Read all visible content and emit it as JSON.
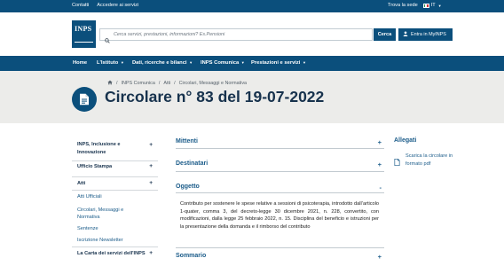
{
  "topbar": {
    "links": [
      "Contatti",
      "Accedere ai servizi"
    ],
    "find_office": "Trova la sede",
    "language": "IT",
    "colors": {
      "bar": "#0b4f7c"
    }
  },
  "header": {
    "logo_text": "INPS",
    "search_placeholder": "Cerca servizi, prestazioni, informazioni? Es.Pensioni",
    "search_button": "Cerca",
    "login_button": "Entra in MyINPS"
  },
  "nav": {
    "items": [
      "Home",
      "L'Istituto",
      "Dati, ricerche e bilanci",
      "INPS Comunica",
      "Prestazioni e servizi"
    ]
  },
  "breadcrumb": [
    "INPS Comunica",
    "Atti",
    "Circolari, Messaggi e Normativa"
  ],
  "page_title": "Circolare n° 83 del 19-07-2022",
  "sidebar": {
    "sections": [
      {
        "label": "INPS, Inclusione e Innovazione",
        "expandable": true
      },
      {
        "label": "Ufficio Stampa",
        "expandable": true
      },
      {
        "label": "Atti",
        "expandable": true,
        "expanded": true,
        "children": [
          "Atti Ufficiali",
          "Circolari, Messaggi e Normativa",
          "Sentenze",
          "Iscrizione Newsletter"
        ]
      },
      {
        "label": "La Carta dei servizi dell'INPS",
        "expandable": true
      }
    ]
  },
  "accordion": {
    "sections": [
      {
        "label": "Mittenti",
        "state": "+"
      },
      {
        "label": "Destinatari",
        "state": "+"
      },
      {
        "label": "Oggetto",
        "state": "-"
      },
      {
        "label": "Sommario",
        "state": "+"
      }
    ],
    "oggetto_text": "Contributo per sostenere le spese relative a sessioni di psicoterapia, introdotto dall’articolo 1-quater, comma 3, del decreto-legge 30 dicembre 2021, n. 228, convertito, con modificazioni, dalla legge 25 febbraio 2022, n. 15. Disciplina del beneficio e istruzioni per la presentazione della domanda e il rimborso del contributo"
  },
  "attachments": {
    "heading": "Allegati",
    "download_link": "Scarica la circolare in formato pdf"
  },
  "icons": [
    "search-icon",
    "user-icon",
    "home-icon",
    "document-icon",
    "pdf-icon",
    "flag-icon"
  ]
}
